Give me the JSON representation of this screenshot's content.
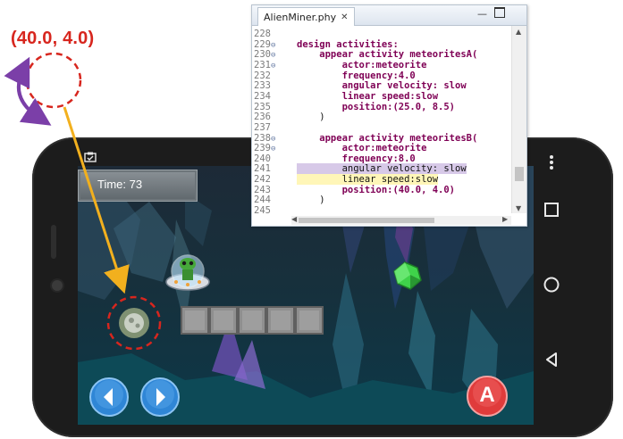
{
  "annotation": {
    "coordinate_label": "(40.0, 4.0)",
    "color": "#d7261e",
    "arrow_color": "#f2b01e",
    "rotation_color": "#7b3fa8"
  },
  "editor": {
    "tab_title": "AlienMiner.phy",
    "tab_close": "✕",
    "min_label": "—",
    "lines": [
      {
        "num": "228",
        "text": ""
      },
      {
        "num": "229",
        "text": "design activities:",
        "fold": true
      },
      {
        "num": "230",
        "text": "    appear activity meteoritesA(",
        "fold": true
      },
      {
        "num": "231",
        "text": "        actor:meteorite",
        "fold": true
      },
      {
        "num": "232",
        "text": "        frequency:4.0"
      },
      {
        "num": "233",
        "text": "        angular velocity: slow"
      },
      {
        "num": "234",
        "text": "        linear speed:slow"
      },
      {
        "num": "235",
        "text": "        position:(25.0, 8.5)"
      },
      {
        "num": "236",
        "text": "    )"
      },
      {
        "num": "237",
        "text": ""
      },
      {
        "num": "238",
        "text": "    appear activity meteoritesB(",
        "fold": true
      },
      {
        "num": "239",
        "text": "        actor:meteorite",
        "fold": true
      },
      {
        "num": "240",
        "text": "        frequency:8.0"
      },
      {
        "num": "241",
        "text": "        angular velocity: slow",
        "highlight": "purple"
      },
      {
        "num": "242",
        "text": "        linear speed:slow",
        "highlight": "yellow"
      },
      {
        "num": "243",
        "text": "        position:(40.0, 4.0)"
      },
      {
        "num": "244",
        "text": "    )"
      },
      {
        "num": "245",
        "text": ""
      }
    ]
  },
  "game": {
    "time_label": "Time: 73",
    "button_a_label": "A",
    "colors": {
      "sky_top": "#1d2a37",
      "cave": "#0c3848",
      "gem": "#3fd34a",
      "button_blue": "#2f86d6",
      "button_red": "#e03b3b"
    }
  },
  "icons": {
    "status": "clipboard-check-icon",
    "more": "more-vert-icon",
    "recent": "square-icon",
    "home": "circle-icon",
    "back": "triangle-back-icon",
    "left": "arrow-left-icon",
    "right": "arrow-right-icon"
  }
}
